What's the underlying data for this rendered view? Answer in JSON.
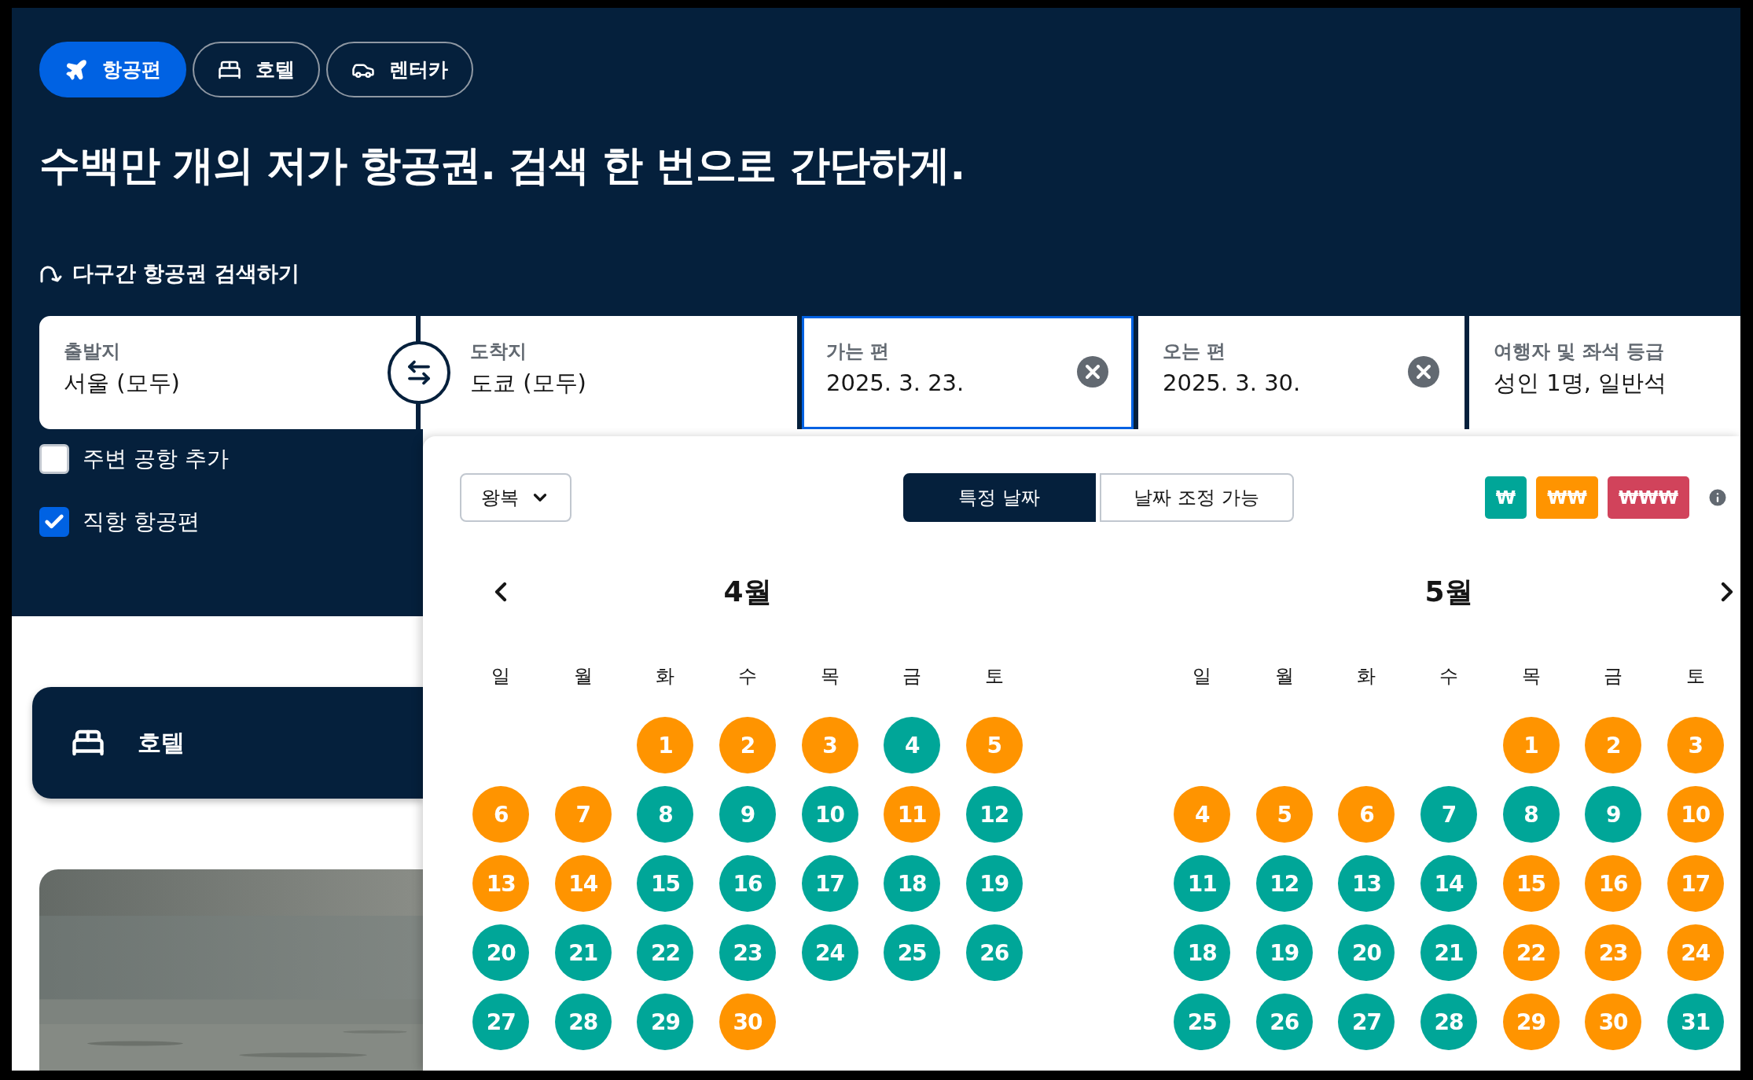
{
  "product_tabs": [
    {
      "label": "항공편",
      "selected": true
    },
    {
      "label": "호텔",
      "selected": false
    },
    {
      "label": "렌터카",
      "selected": false
    }
  ],
  "headline": "수백만 개의 저가 항공권. 검색 한 번으로 간단하게.",
  "multi_city_link": "다구간 항공권 검색하기",
  "search_fields": [
    {
      "label": "출발지",
      "value": "서울 (모두)",
      "selected": false,
      "clearable": false
    },
    {
      "label": "도착지",
      "value": "도쿄 (모두)",
      "selected": false,
      "clearable": false
    },
    {
      "label": "가는 편",
      "value": "2025. 3. 23.",
      "selected": true,
      "clearable": true
    },
    {
      "label": "오는 편",
      "value": "2025. 3. 30.",
      "selected": false,
      "clearable": true
    },
    {
      "label": "여행자 및 좌석 등급",
      "value": "성인 1명, 일반석",
      "selected": false,
      "clearable": false
    }
  ],
  "options": [
    {
      "label": "주변 공항 추가",
      "checked": false
    },
    {
      "label": "직항 항공편",
      "checked": true
    }
  ],
  "hotel_card": {
    "label": "호텔"
  },
  "calendar": {
    "trip_type": "왕복",
    "date_modes": [
      {
        "label": "특정 날짜",
        "selected": true
      },
      {
        "label": "날짜 조정 가능",
        "selected": false
      }
    ],
    "price_legend": [
      {
        "label": "₩",
        "color": "#00a698"
      },
      {
        "label": "₩₩",
        "color": "#ff9400"
      },
      {
        "label": "₩₩₩",
        "color": "#d1435b"
      }
    ],
    "months": [
      {
        "title": "4월",
        "weekdays": [
          "일",
          "월",
          "화",
          "수",
          "목",
          "금",
          "토"
        ],
        "days": [
          {
            "kind": "blank"
          },
          {
            "kind": "blank"
          },
          {
            "kind": "day",
            "label": "1",
            "color": "#ff9400"
          },
          {
            "kind": "day",
            "label": "2",
            "color": "#ff9400"
          },
          {
            "kind": "day",
            "label": "3",
            "color": "#ff9400"
          },
          {
            "kind": "day",
            "label": "4",
            "color": "#00a698"
          },
          {
            "kind": "day",
            "label": "5",
            "color": "#ff9400"
          },
          {
            "kind": "day",
            "label": "6",
            "color": "#ff9400"
          },
          {
            "kind": "day",
            "label": "7",
            "color": "#ff9400"
          },
          {
            "kind": "day",
            "label": "8",
            "color": "#00a698"
          },
          {
            "kind": "day",
            "label": "9",
            "color": "#00a698"
          },
          {
            "kind": "day",
            "label": "10",
            "color": "#00a698"
          },
          {
            "kind": "day",
            "label": "11",
            "color": "#ff9400"
          },
          {
            "kind": "day",
            "label": "12",
            "color": "#00a698"
          },
          {
            "kind": "day",
            "label": "13",
            "color": "#ff9400"
          },
          {
            "kind": "day",
            "label": "14",
            "color": "#ff9400"
          },
          {
            "kind": "day",
            "label": "15",
            "color": "#00a698"
          },
          {
            "kind": "day",
            "label": "16",
            "color": "#00a698"
          },
          {
            "kind": "day",
            "label": "17",
            "color": "#00a698"
          },
          {
            "kind": "day",
            "label": "18",
            "color": "#00a698"
          },
          {
            "kind": "day",
            "label": "19",
            "color": "#00a698"
          },
          {
            "kind": "day",
            "label": "20",
            "color": "#00a698"
          },
          {
            "kind": "day",
            "label": "21",
            "color": "#00a698"
          },
          {
            "kind": "day",
            "label": "22",
            "color": "#00a698"
          },
          {
            "kind": "day",
            "label": "23",
            "color": "#00a698"
          },
          {
            "kind": "day",
            "label": "24",
            "color": "#00a698"
          },
          {
            "kind": "day",
            "label": "25",
            "color": "#00a698"
          },
          {
            "kind": "day",
            "label": "26",
            "color": "#00a698"
          },
          {
            "kind": "day",
            "label": "27",
            "color": "#00a698"
          },
          {
            "kind": "day",
            "label": "28",
            "color": "#00a698"
          },
          {
            "kind": "day",
            "label": "29",
            "color": "#00a698"
          },
          {
            "kind": "day",
            "label": "30",
            "color": "#ff9400"
          }
        ]
      },
      {
        "title": "5월",
        "weekdays": [
          "일",
          "월",
          "화",
          "수",
          "목",
          "금",
          "토"
        ],
        "days": [
          {
            "kind": "blank"
          },
          {
            "kind": "blank"
          },
          {
            "kind": "blank"
          },
          {
            "kind": "blank"
          },
          {
            "kind": "day",
            "label": "1",
            "color": "#ff9400"
          },
          {
            "kind": "day",
            "label": "2",
            "color": "#ff9400"
          },
          {
            "kind": "day",
            "label": "3",
            "color": "#ff9400"
          },
          {
            "kind": "day",
            "label": "4",
            "color": "#ff9400"
          },
          {
            "kind": "day",
            "label": "5",
            "color": "#ff9400"
          },
          {
            "kind": "day",
            "label": "6",
            "color": "#ff9400"
          },
          {
            "kind": "day",
            "label": "7",
            "color": "#00a698"
          },
          {
            "kind": "day",
            "label": "8",
            "color": "#00a698"
          },
          {
            "kind": "day",
            "label": "9",
            "color": "#00a698"
          },
          {
            "kind": "day",
            "label": "10",
            "color": "#ff9400"
          },
          {
            "kind": "day",
            "label": "11",
            "color": "#00a698"
          },
          {
            "kind": "day",
            "label": "12",
            "color": "#00a698"
          },
          {
            "kind": "day",
            "label": "13",
            "color": "#00a698"
          },
          {
            "kind": "day",
            "label": "14",
            "color": "#00a698"
          },
          {
            "kind": "day",
            "label": "15",
            "color": "#ff9400"
          },
          {
            "kind": "day",
            "label": "16",
            "color": "#ff9400"
          },
          {
            "kind": "day",
            "label": "17",
            "color": "#ff9400"
          },
          {
            "kind": "day",
            "label": "18",
            "color": "#00a698"
          },
          {
            "kind": "day",
            "label": "19",
            "color": "#00a698"
          },
          {
            "kind": "day",
            "label": "20",
            "color": "#00a698"
          },
          {
            "kind": "day",
            "label": "21",
            "color": "#00a698"
          },
          {
            "kind": "day",
            "label": "22",
            "color": "#ff9400"
          },
          {
            "kind": "day",
            "label": "23",
            "color": "#ff9400"
          },
          {
            "kind": "day",
            "label": "24",
            "color": "#ff9400"
          },
          {
            "kind": "day",
            "label": "25",
            "color": "#00a698"
          },
          {
            "kind": "day",
            "label": "26",
            "color": "#00a698"
          },
          {
            "kind": "day",
            "label": "27",
            "color": "#00a698"
          },
          {
            "kind": "day",
            "label": "28",
            "color": "#00a698"
          },
          {
            "kind": "day",
            "label": "29",
            "color": "#ff9400"
          },
          {
            "kind": "day",
            "label": "30",
            "color": "#ff9400"
          },
          {
            "kind": "day",
            "label": "31",
            "color": "#00a698"
          }
        ]
      }
    ]
  }
}
